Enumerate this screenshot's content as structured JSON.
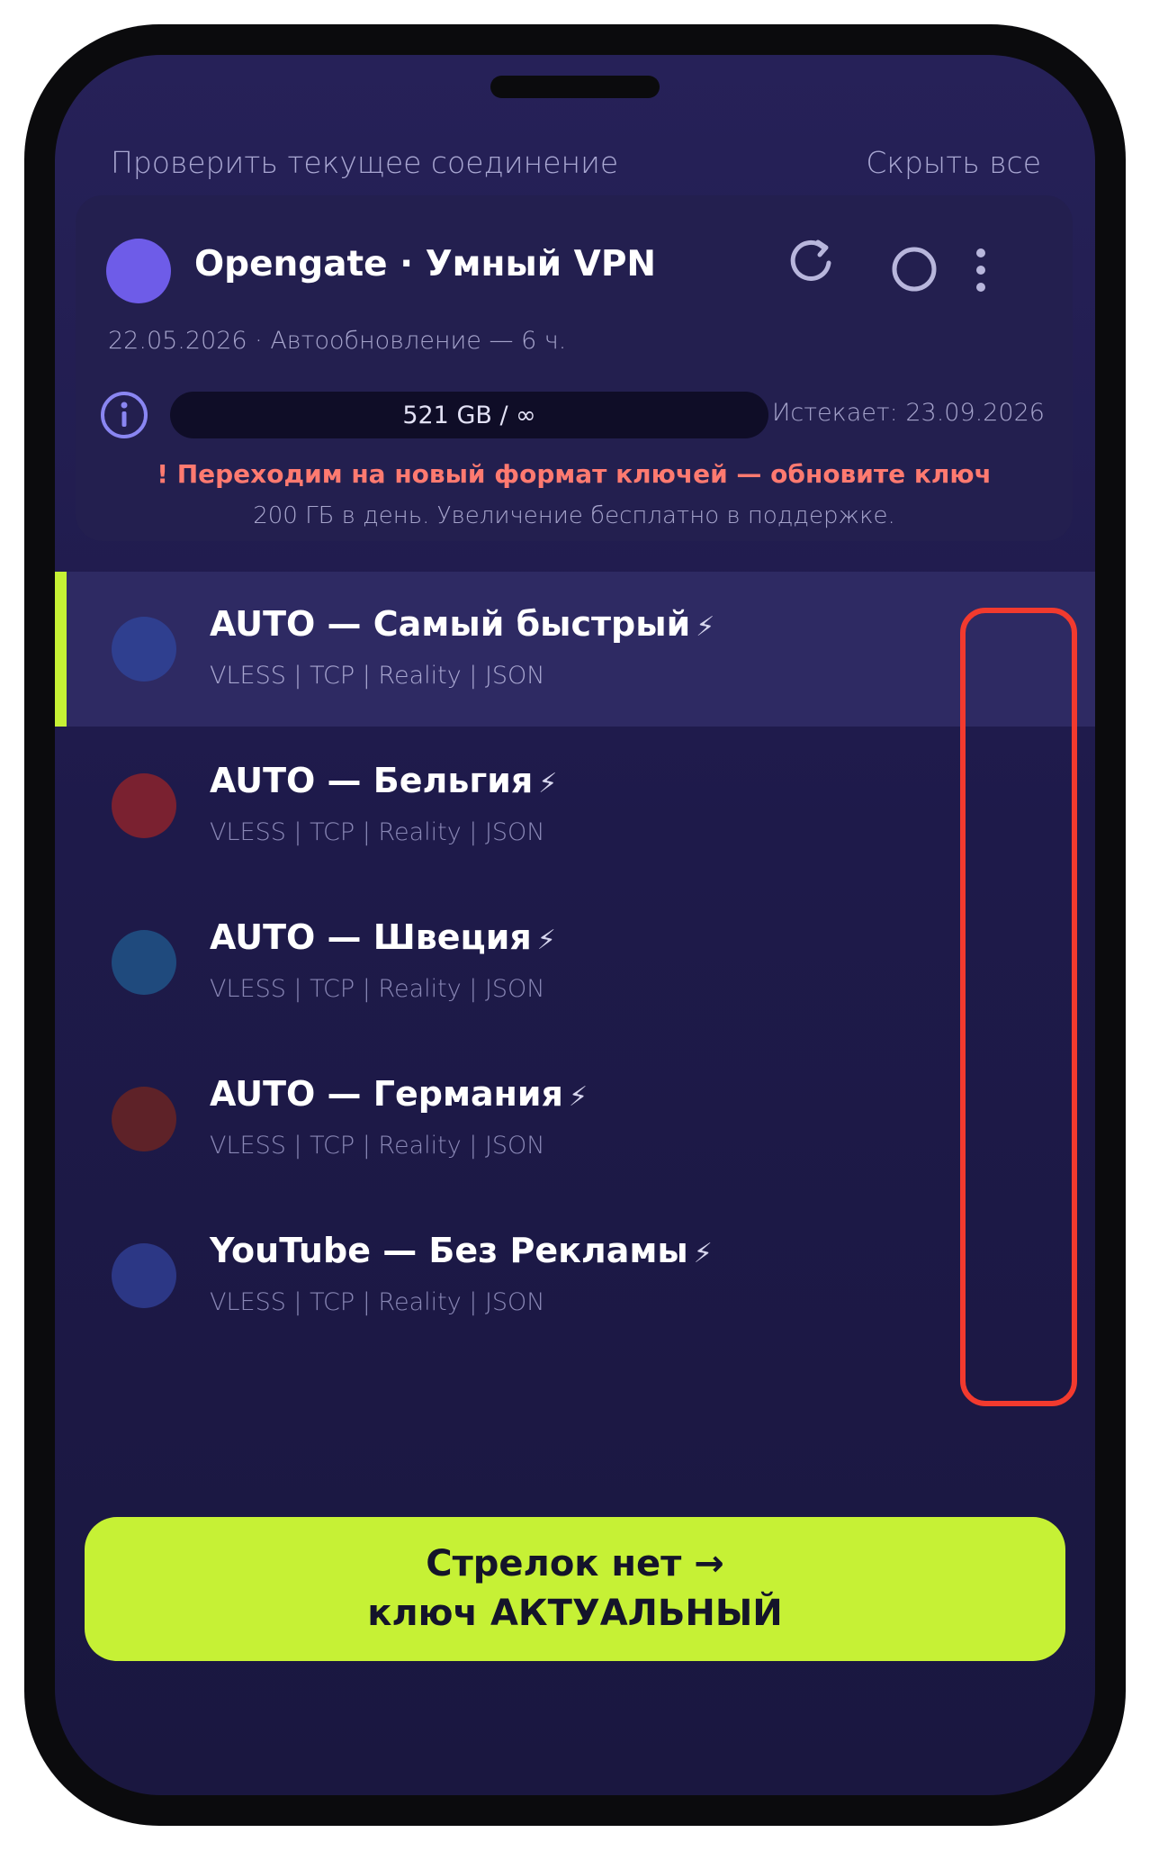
{
  "header": {
    "check_connection": "Проверить текущее соединение",
    "hide_all": "Скрыть все"
  },
  "card": {
    "title": "Opengate · Умный VPN",
    "subtitle": "22.05.2026 · Автообновление — 6 ч.",
    "traffic": "521 GB / ∞",
    "expires": "Истекает: 23.09.2026",
    "warning": "! Переходим на новый формат ключей — обновите ключ",
    "warning_sub": "200 ГБ в день. Увеличение бесплатно в поддержке.",
    "avatar_color": "#6e5ce8",
    "icons": [
      "refresh-icon",
      "power-icon",
      "more-vertical-icon",
      "info-icon"
    ]
  },
  "servers": [
    {
      "name": "AUTO — Самый быстрый",
      "bolt": "⚡",
      "protocol": "VLESS | TCP | Reality | JSON",
      "color": "#2f3f8f",
      "active": true
    },
    {
      "name": "AUTO — Бельгия",
      "bolt": "⚡",
      "protocol": "VLESS | TCP | Reality | JSON",
      "color": "#7a2130",
      "active": false
    },
    {
      "name": "AUTO — Швеция",
      "bolt": "⚡",
      "protocol": "VLESS | TCP | Reality | JSON",
      "color": "#1f4a7d",
      "active": false
    },
    {
      "name": "AUTO — Германия",
      "bolt": "⚡",
      "protocol": "VLESS | TCP | Reality | JSON",
      "color": "#5e2228",
      "active": false
    },
    {
      "name": "YouTube — Без Рекламы",
      "bolt": "⚡",
      "protocol": "VLESS | TCP | Reality | JSON",
      "color": "#2c3785",
      "active": false
    }
  ],
  "cta": {
    "line1": "Стрелок нет →",
    "line2": "ключ АКТУАЛЬНЫЙ"
  },
  "colors": {
    "accent": "#c6f135",
    "highlight_frame": "#f23a2e",
    "warning": "#ff7a70"
  }
}
